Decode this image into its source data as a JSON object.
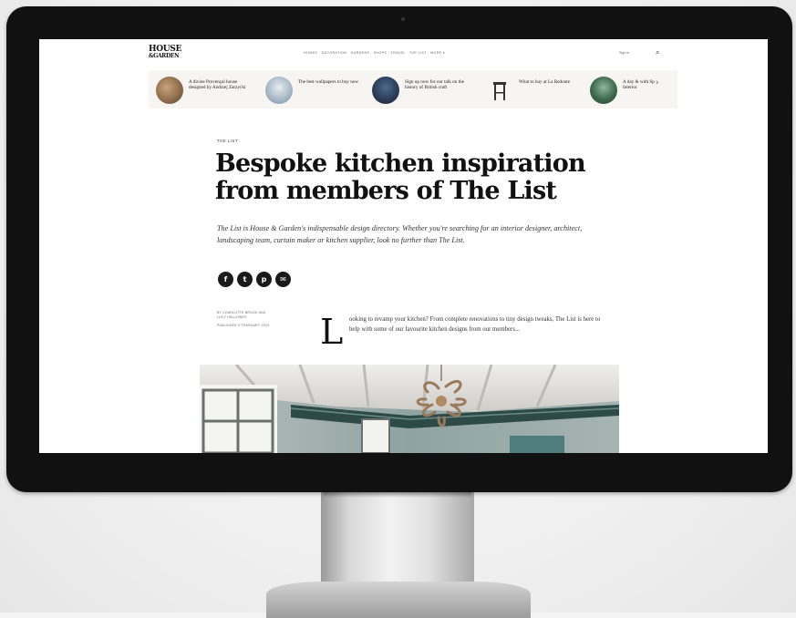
{
  "site": {
    "logo_line1": "HOUSE",
    "logo_line2": "&GARDEN"
  },
  "nav": {
    "menu_text": "HOMES  ·  DECORATION  ·  GARDENS  ·  SHOPS  ·  TRAVEL  ·  THE LIST  ·  MORE  ▾",
    "util_text": "Sign in  ·",
    "search_icon": "search-icon"
  },
  "promos": [
    {
      "text": "A divine Provençal house designed by Andrzej Zarzycki",
      "color": "#8a6a4a"
    },
    {
      "text": "The best wallpapers to buy now",
      "color": "#7b8fa4"
    },
    {
      "text": "Sign up now for our talk on the history of British craft",
      "color": "#2d3e59"
    },
    {
      "text": "What to buy at La Redoute",
      "color": "#3b3b3b"
    },
    {
      "text": "A day & with Sp Interior",
      "color": "#3e6a4e"
    }
  ],
  "article": {
    "kicker": "THE LIST",
    "title": "Bespoke kitchen inspiration from members of The List",
    "dek": "The List is House & Garden's indispensable design directory. Whether you're searching for an interior designer, architect, landscaping team, curtain maker or kitchen supplier, look no further than The List.",
    "byline_line1": "BY CHARLOTTE BROOK AND",
    "byline_line2": "LUCY HALLOWES",
    "byline_date": "PUBLISHED 9 FEBRUARY 2023",
    "dropcap": "L",
    "intro": "ooking to revamp your kitchen? From complete renovations to tiny design tweaks, The List is here to help with some of our favourite kitchen designs from our members..."
  },
  "share": [
    {
      "icon": "facebook-icon",
      "glyph": "f"
    },
    {
      "icon": "twitter-icon",
      "glyph": "t"
    },
    {
      "icon": "pinterest-icon",
      "glyph": "p"
    },
    {
      "icon": "email-icon",
      "glyph": "✉"
    }
  ],
  "colors": {
    "bezel": "#111111",
    "text": "#111111",
    "promo_bg": "#f7f5f2"
  }
}
